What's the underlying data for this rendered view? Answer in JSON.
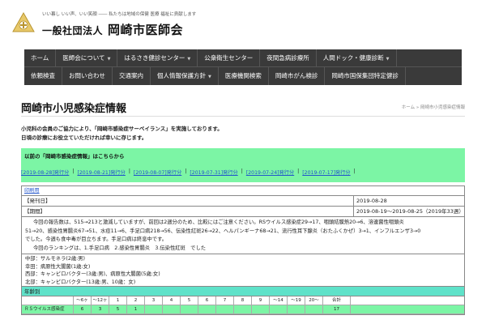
{
  "header": {
    "tagline": "いい暮し いい声、いい笑顔 ―― 私たちは地域の保健 医療 福祉に貢献します",
    "org_prefix": "一般社団法人",
    "org_name": "岡崎市医師会",
    "logo_icon": "medical-association-emblem-icon"
  },
  "nav": {
    "row1": [
      {
        "label": "ホーム",
        "dropdown": false
      },
      {
        "label": "医師会について",
        "dropdown": true
      },
      {
        "label": "はるさき健診センター",
        "dropdown": true
      },
      {
        "label": "公衆衛生センター",
        "dropdown": false
      },
      {
        "label": "夜間急病診療所",
        "dropdown": false
      },
      {
        "label": "人間ドック・健康診断",
        "dropdown": true
      }
    ],
    "row2": [
      {
        "label": "依頼検査",
        "dropdown": false
      },
      {
        "label": "お問い合わせ",
        "dropdown": false
      },
      {
        "label": "交通案内",
        "dropdown": false
      },
      {
        "label": "個人情報保護方針",
        "dropdown": true
      },
      {
        "label": "医療機関検索",
        "dropdown": false
      },
      {
        "label": "岡崎市がん検診",
        "dropdown": false
      },
      {
        "label": "岡崎市国保集団特定健診",
        "dropdown": false
      }
    ]
  },
  "page": {
    "title": "岡崎市小児感染症情報",
    "breadcrumb": "ホーム » 岡崎市小児感染症情報",
    "intro_line1": "小児科の会員のご協力により、「岡崎市感染症サーベイランス」を実施しております。",
    "intro_line2": "日頃の診療にお役立ていただければ幸いに存じます。"
  },
  "past": {
    "heading": "以前の「岡崎市感染症情報」はこちらから",
    "links": [
      "[2019-08-28]発行分",
      "[2019-08-21]発行分",
      "[2019-08-07]発行分",
      "[2019-07-31]発行分",
      "[2019-07-24]発行分",
      "[2019-07-17]発行分"
    ],
    "separator": "|"
  },
  "report": {
    "print_label": "印刷用",
    "issued_key": "【発刊日】",
    "issued_value": "2019-08-28",
    "period_key": "【期間】",
    "period_value": "2019-08-19～2019-08-25（2019年33週）",
    "summary_line1": "今回の報告数は、515→213と激減していますが、前回は2週分のため、比較にはご注意ください。RSウイルス感染症29→17、咽頭結膜熱20→6、溶連菌性咽頭炎",
    "summary_line2": "51→20、感染性胃腸炎67→51、水痘11→6、手足口病218→56、伝染性紅斑26→22、ヘルパンギーナ68→21、流行性耳下腺炎（おたふくかぜ）3→1、インフルエンザ3→0",
    "summary_line3": "でした。今週も食中毒が目立ちます。手足口病は終息中です。",
    "summary_line4": "今回のランキングは、1.手足口病　2.感染性胃腸炎　3.伝染性紅斑　でした",
    "region1": "中部：サルモネラ(2歳:男)",
    "region2": "幸田：病原性大腸菌(1歳:女)",
    "region3": "西部：キャンピロバクター(3歳:男)、病原性大腸菌(5歳:女)",
    "region4": "北部：キャンピロバクター(13歳:男、10歳：女)",
    "age_header": "年齢別"
  },
  "age_table": {
    "columns": [
      "～6ヶ",
      "～12ヶ",
      "1",
      "2",
      "3",
      "4",
      "5",
      "6",
      "7",
      "8",
      "9",
      "～14",
      "～19",
      "20～",
      "合計"
    ],
    "rows": [
      {
        "name": "ＲＳウイルス感染症",
        "values": [
          "6",
          "3",
          "5",
          "1",
          "",
          "",
          "",
          "",
          "",
          "",
          "",
          "",
          "",
          "",
          "17"
        ]
      }
    ]
  }
}
